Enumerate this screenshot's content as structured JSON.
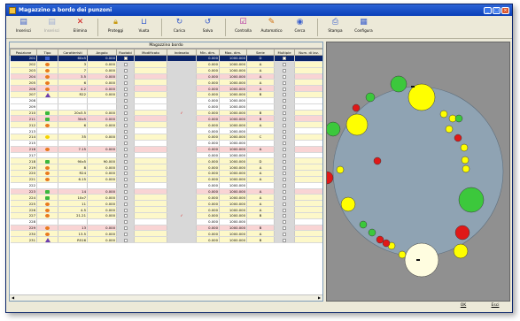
{
  "window": {
    "title": "Magazzino a bordo dei punzoni"
  },
  "toolbar": {
    "tools": [
      {
        "label": "Inserisci",
        "icon": "insert-icon",
        "enabled": true
      },
      {
        "label": "Inserisci",
        "icon": "insert-after-icon",
        "enabled": false
      },
      {
        "label": "Elimina",
        "icon": "delete-icon",
        "enabled": true
      },
      {
        "label": "Proteggi",
        "icon": "protect-icon",
        "enabled": true
      },
      {
        "label": "Vuota",
        "icon": "empty-icon",
        "enabled": true
      },
      {
        "label": "Carica",
        "icon": "load-icon",
        "enabled": true
      },
      {
        "label": "Salva",
        "icon": "save-icon",
        "enabled": true
      },
      {
        "label": "Controlla",
        "icon": "check-icon",
        "enabled": true
      },
      {
        "label": "Automatico",
        "icon": "automatic-icon",
        "enabled": true
      },
      {
        "label": "Cerca",
        "icon": "search-icon",
        "enabled": true
      },
      {
        "label": "Stampa",
        "icon": "print-icon",
        "enabled": true
      },
      {
        "label": "Configura",
        "icon": "configure-icon",
        "enabled": true
      }
    ]
  },
  "grid": {
    "title": "Magazzino bordo",
    "columns": [
      "Posizione",
      "Tipo",
      "Caratteristi",
      "Angolo",
      "Ruotabi",
      "Modificato",
      "Indexato",
      "Min. dim.",
      "Max. dim.",
      "Serie",
      "Multiple",
      "Num. di lav."
    ],
    "rows": [
      {
        "pos": "201",
        "type": "flag",
        "car": "60x5",
        "ang": "0.000",
        "mark": "",
        "min": "0.000",
        "max": "1000.000",
        "serie": "D",
        "style": "sel"
      },
      {
        "pos": "202",
        "type": "orange",
        "car": "3",
        "ang": "0.000",
        "mark": "",
        "min": "0.000",
        "max": "1000.000",
        "serie": "A",
        "style": "yellow"
      },
      {
        "pos": "203",
        "type": "orange",
        "car": "7",
        "ang": "0.000",
        "mark": "",
        "min": "0.000",
        "max": "1000.000",
        "serie": "A",
        "style": "yellow"
      },
      {
        "pos": "204",
        "type": "orange",
        "car": "3.5",
        "ang": "0.000",
        "mark": "",
        "min": "0.000",
        "max": "1000.000",
        "serie": "A",
        "style": "pink"
      },
      {
        "pos": "205",
        "type": "orange",
        "car": "6",
        "ang": "0.000",
        "mark": "",
        "min": "0.000",
        "max": "1000.000",
        "serie": "A",
        "style": "yellow"
      },
      {
        "pos": "206",
        "type": "orange",
        "car": "4.2",
        "ang": "0.000",
        "mark": "",
        "min": "0.000",
        "max": "1000.000",
        "serie": "A",
        "style": "pink"
      },
      {
        "pos": "207",
        "type": "purple",
        "car": "R22",
        "ang": "0.000",
        "mark": "",
        "min": "0.000",
        "max": "1000.000",
        "serie": "B",
        "style": "yellow"
      },
      {
        "pos": "208",
        "type": "",
        "car": "",
        "ang": "",
        "mark": "",
        "min": "0.000",
        "max": "1000.000",
        "serie": "",
        "style": "plain"
      },
      {
        "pos": "209",
        "type": "",
        "car": "",
        "ang": "",
        "mark": "",
        "min": "0.000",
        "max": "1000.000",
        "serie": "",
        "style": "plain"
      },
      {
        "pos": "210",
        "type": "green",
        "car": "20x3.5",
        "ang": "0.000",
        "mark": "✓",
        "min": "0.000",
        "max": "1000.000",
        "serie": "B",
        "style": "yellow"
      },
      {
        "pos": "211",
        "type": "green",
        "car": "30x5",
        "ang": "0.000",
        "mark": "",
        "min": "0.000",
        "max": "1000.000",
        "serie": "B",
        "style": "pink"
      },
      {
        "pos": "212",
        "type": "orange",
        "car": "6",
        "ang": "0.000",
        "mark": "",
        "min": "0.000",
        "max": "1000.000",
        "serie": "A",
        "style": "yellow"
      },
      {
        "pos": "213",
        "type": "",
        "car": "",
        "ang": "",
        "mark": "",
        "min": "0.000",
        "max": "1000.000",
        "serie": "",
        "style": "plain"
      },
      {
        "pos": "214",
        "type": "yellow",
        "car": "35",
        "ang": "0.000",
        "mark": "",
        "min": "0.000",
        "max": "1000.000",
        "serie": "C",
        "style": "yellow"
      },
      {
        "pos": "215",
        "type": "",
        "car": "",
        "ang": "",
        "mark": "",
        "min": "0.000",
        "max": "1000.000",
        "serie": "",
        "style": "plain"
      },
      {
        "pos": "216",
        "type": "orange",
        "car": "7.15",
        "ang": "0.000",
        "mark": "",
        "min": "0.000",
        "max": "1000.000",
        "serie": "A",
        "style": "pink"
      },
      {
        "pos": "217",
        "type": "",
        "car": "",
        "ang": "",
        "mark": "",
        "min": "0.000",
        "max": "1000.000",
        "serie": "",
        "style": "plain"
      },
      {
        "pos": "218",
        "type": "green",
        "car": "90x5",
        "ang": "90.000",
        "mark": "",
        "min": "0.000",
        "max": "1000.000",
        "serie": "D",
        "style": "yellow"
      },
      {
        "pos": "219",
        "type": "orange",
        "car": "8",
        "ang": "0.000",
        "mark": "",
        "min": "0.000",
        "max": "1000.000",
        "serie": "A",
        "style": "yellow"
      },
      {
        "pos": "220",
        "type": "orange",
        "car": "R24",
        "ang": "0.000",
        "mark": "",
        "min": "0.000",
        "max": "1000.000",
        "serie": "A",
        "style": "yellow"
      },
      {
        "pos": "221",
        "type": "orange",
        "car": "6.15",
        "ang": "0.000",
        "mark": "",
        "min": "0.000",
        "max": "1000.000",
        "serie": "A",
        "style": "yellow"
      },
      {
        "pos": "222",
        "type": "",
        "car": "",
        "ang": "",
        "mark": "",
        "min": "0.000",
        "max": "1000.000",
        "serie": "",
        "style": "plain"
      },
      {
        "pos": "223",
        "type": "green",
        "car": "14",
        "ang": "0.000",
        "mark": "",
        "min": "0.000",
        "max": "1000.000",
        "serie": "A",
        "style": "pink"
      },
      {
        "pos": "224",
        "type": "green",
        "car": "10x7",
        "ang": "0.000",
        "mark": "",
        "min": "0.000",
        "max": "1000.000",
        "serie": "A",
        "style": "yellow"
      },
      {
        "pos": "225",
        "type": "orange",
        "car": "11",
        "ang": "0.000",
        "mark": "",
        "min": "0.000",
        "max": "1000.000",
        "serie": "A",
        "style": "yellow"
      },
      {
        "pos": "226",
        "type": "orange",
        "car": "4.5",
        "ang": "0.000",
        "mark": "",
        "min": "0.000",
        "max": "1000.000",
        "serie": "A",
        "style": "yellow"
      },
      {
        "pos": "227",
        "type": "orange",
        "car": "21.21",
        "ang": "0.000",
        "mark": "✓",
        "min": "0.000",
        "max": "1000.000",
        "serie": "B",
        "style": "yellow"
      },
      {
        "pos": "228",
        "type": "",
        "car": "",
        "ang": "",
        "mark": "",
        "min": "0.000",
        "max": "1000.000",
        "serie": "",
        "style": "plain"
      },
      {
        "pos": "229",
        "type": "orange",
        "car": "13",
        "ang": "0.000",
        "mark": "",
        "min": "0.000",
        "max": "1000.000",
        "serie": "B",
        "style": "pink"
      },
      {
        "pos": "230",
        "type": "orange",
        "car": "13.5",
        "ang": "0.000",
        "mark": "",
        "min": "0.000",
        "max": "1000.000",
        "serie": "A",
        "style": "yellow"
      },
      {
        "pos": "231",
        "type": "purple",
        "car": "R516",
        "ang": "0.000",
        "mark": "",
        "min": "0.000",
        "max": "1000.000",
        "serie": "B",
        "style": "yellow"
      }
    ]
  },
  "turret": {
    "disc_color": "#8fa3b3",
    "background": "#909090",
    "tools": [
      {
        "color": "#3cc83c",
        "r": 9
      },
      {
        "color": "#3cc83c",
        "r": 5
      },
      {
        "color": "#e01818",
        "r": 4
      },
      {
        "color": "#ffff00",
        "r": 15
      },
      {
        "color": "#ffff00",
        "r": 4
      },
      {
        "color": "#ffff00",
        "r": 4
      },
      {
        "color": "#3cc83c",
        "r": 4
      },
      {
        "color": "#ffff00",
        "r": 4
      },
      {
        "color": "#e01818",
        "r": 4
      },
      {
        "color": "#ffff00",
        "r": 4
      },
      {
        "color": "#ffff00",
        "r": 4
      },
      {
        "color": "#ffff00",
        "r": 4
      },
      {
        "color": "#3cc83c",
        "r": 14
      },
      {
        "color": "#e01818",
        "r": 8
      },
      {
        "color": "#ffff00",
        "r": 8
      },
      {
        "color": "#fffde0",
        "r": 19
      },
      {
        "color": "#ffff00",
        "r": 4
      },
      {
        "color": "#ffff00",
        "r": 4
      },
      {
        "color": "#e01818",
        "r": 4
      },
      {
        "color": "#e01818",
        "r": 4
      },
      {
        "color": "#3cc83c",
        "r": 4
      },
      {
        "color": "#3cc83c",
        "r": 4
      },
      {
        "color": "#ffff00",
        "r": 8
      },
      {
        "color": "#e01818",
        "r": 7
      },
      {
        "color": "#ffff00",
        "r": 4
      },
      {
        "color": "#3cc83c",
        "r": 8
      },
      {
        "color": "#ffff00",
        "r": 12
      },
      {
        "color": "#e01818",
        "r": 4
      }
    ]
  },
  "buttons": {
    "ok": "OK",
    "exit": "Esci"
  }
}
